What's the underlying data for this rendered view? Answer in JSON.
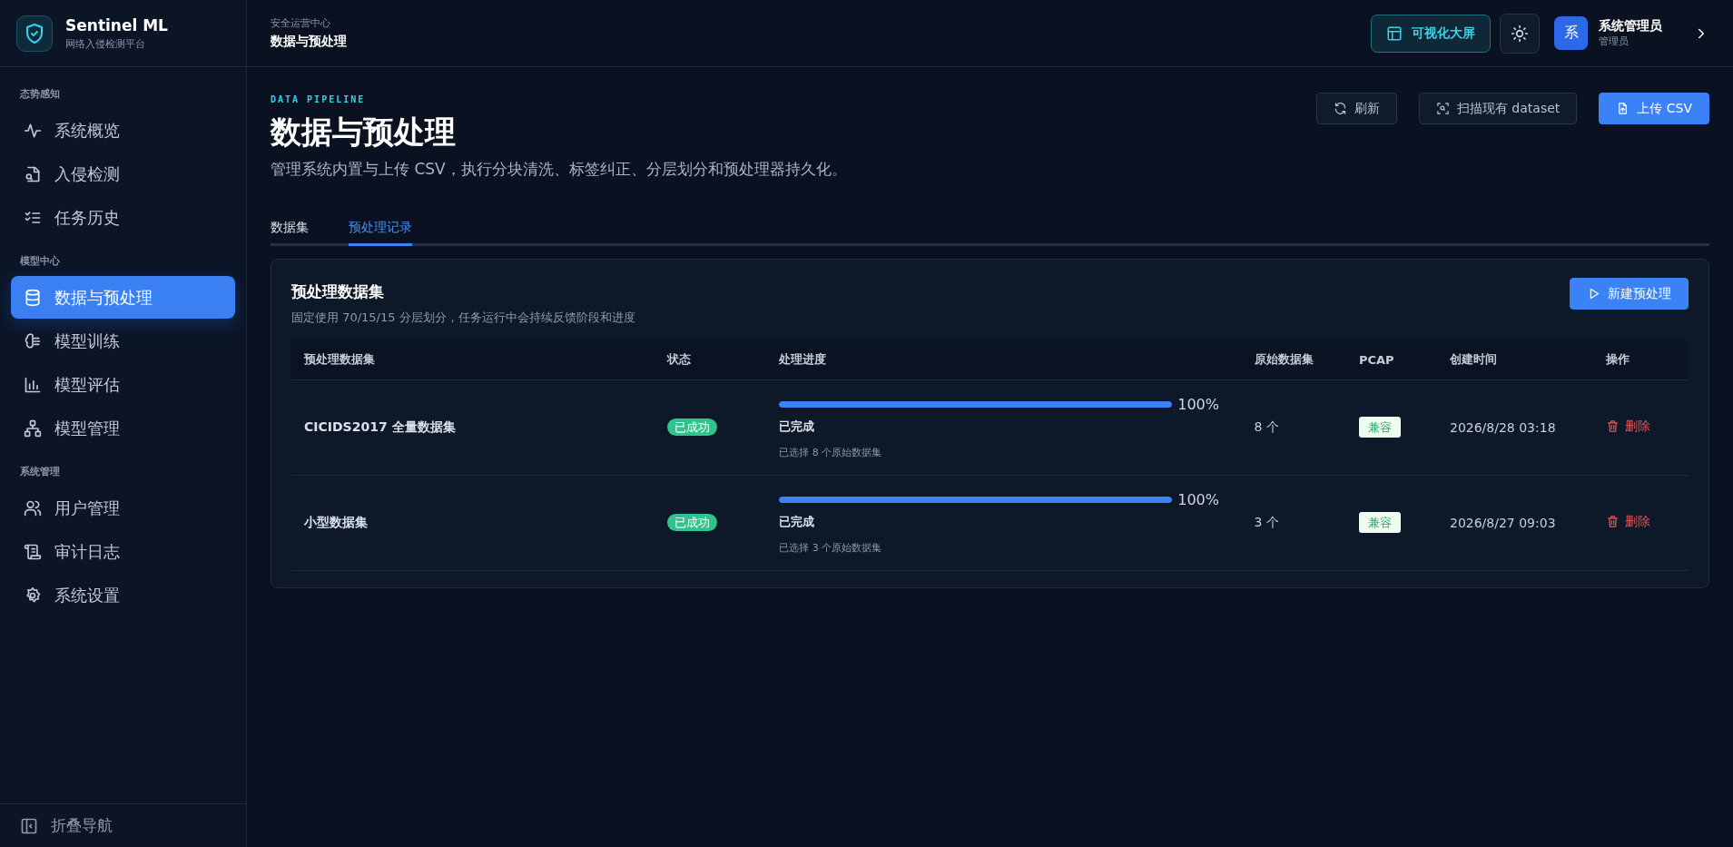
{
  "brand": {
    "name": "Sentinel ML",
    "subtitle": "网络入侵检测平台"
  },
  "sidebar": {
    "sections": [
      {
        "title": "态势感知",
        "items": [
          {
            "label": "系统概览",
            "selected": false
          },
          {
            "label": "入侵检测",
            "selected": false
          },
          {
            "label": "任务历史",
            "selected": false
          }
        ]
      },
      {
        "title": "模型中心",
        "items": [
          {
            "label": "数据与预处理",
            "selected": true
          },
          {
            "label": "模型训练",
            "selected": false
          },
          {
            "label": "模型评估",
            "selected": false
          },
          {
            "label": "模型管理",
            "selected": false
          }
        ]
      },
      {
        "title": "系统管理",
        "items": [
          {
            "label": "用户管理",
            "selected": false
          },
          {
            "label": "审计日志",
            "selected": false
          },
          {
            "label": "系统设置",
            "selected": false
          }
        ]
      }
    ],
    "collapse": "折叠导航"
  },
  "header": {
    "breadcrumb": {
      "parent": "安全运营中心",
      "current": "数据与预处理"
    },
    "screen_button": "可视化大屏",
    "user": {
      "avatar": "系",
      "name": "系统管理员",
      "role": "管理员"
    }
  },
  "page": {
    "eyebrow": "DATA PIPELINE",
    "title": "数据与预处理",
    "description": "管理系统内置与上传 CSV，执行分块清洗、标签纠正、分层划分和预处理器持久化。",
    "actions": [
      {
        "label": "刷新",
        "kind": "secondary"
      },
      {
        "label": "扫描现有 dataset",
        "kind": "secondary"
      },
      {
        "label": "上传 CSV",
        "kind": "primary"
      }
    ],
    "tabs": [
      {
        "label": "数据集",
        "selected": false
      },
      {
        "label": "预处理记录",
        "selected": true
      }
    ]
  },
  "panel": {
    "title": "预处理数据集",
    "subtitle": "固定使用 70/15/15 分层划分，任务运行中会持续反馈阶段和进度",
    "button": "新建预处理",
    "table": {
      "columns": [
        "预处理数据集",
        "状态",
        "处理进度",
        "原始数据集",
        "PCAP",
        "创建时间",
        "操作"
      ],
      "rows": [
        {
          "name": "CICIDS2017 全量数据集",
          "status": "已成功",
          "progress": {
            "level": 1,
            "percent": "100%",
            "stage": "已完成",
            "detail": "已选择 8 个原始数据集"
          },
          "source_count": "8 个",
          "pcap": "兼容",
          "created": "2026/8/28 03:18",
          "action": "删除"
        },
        {
          "name": "小型数据集",
          "status": "已成功",
          "progress": {
            "level": 1,
            "percent": "100%",
            "stage": "已完成",
            "detail": "已选择 3 个原始数据集"
          },
          "source_count": "3 个",
          "pcap": "兼容",
          "created": "2026/8/27 09:03",
          "action": "删除"
        }
      ]
    }
  }
}
